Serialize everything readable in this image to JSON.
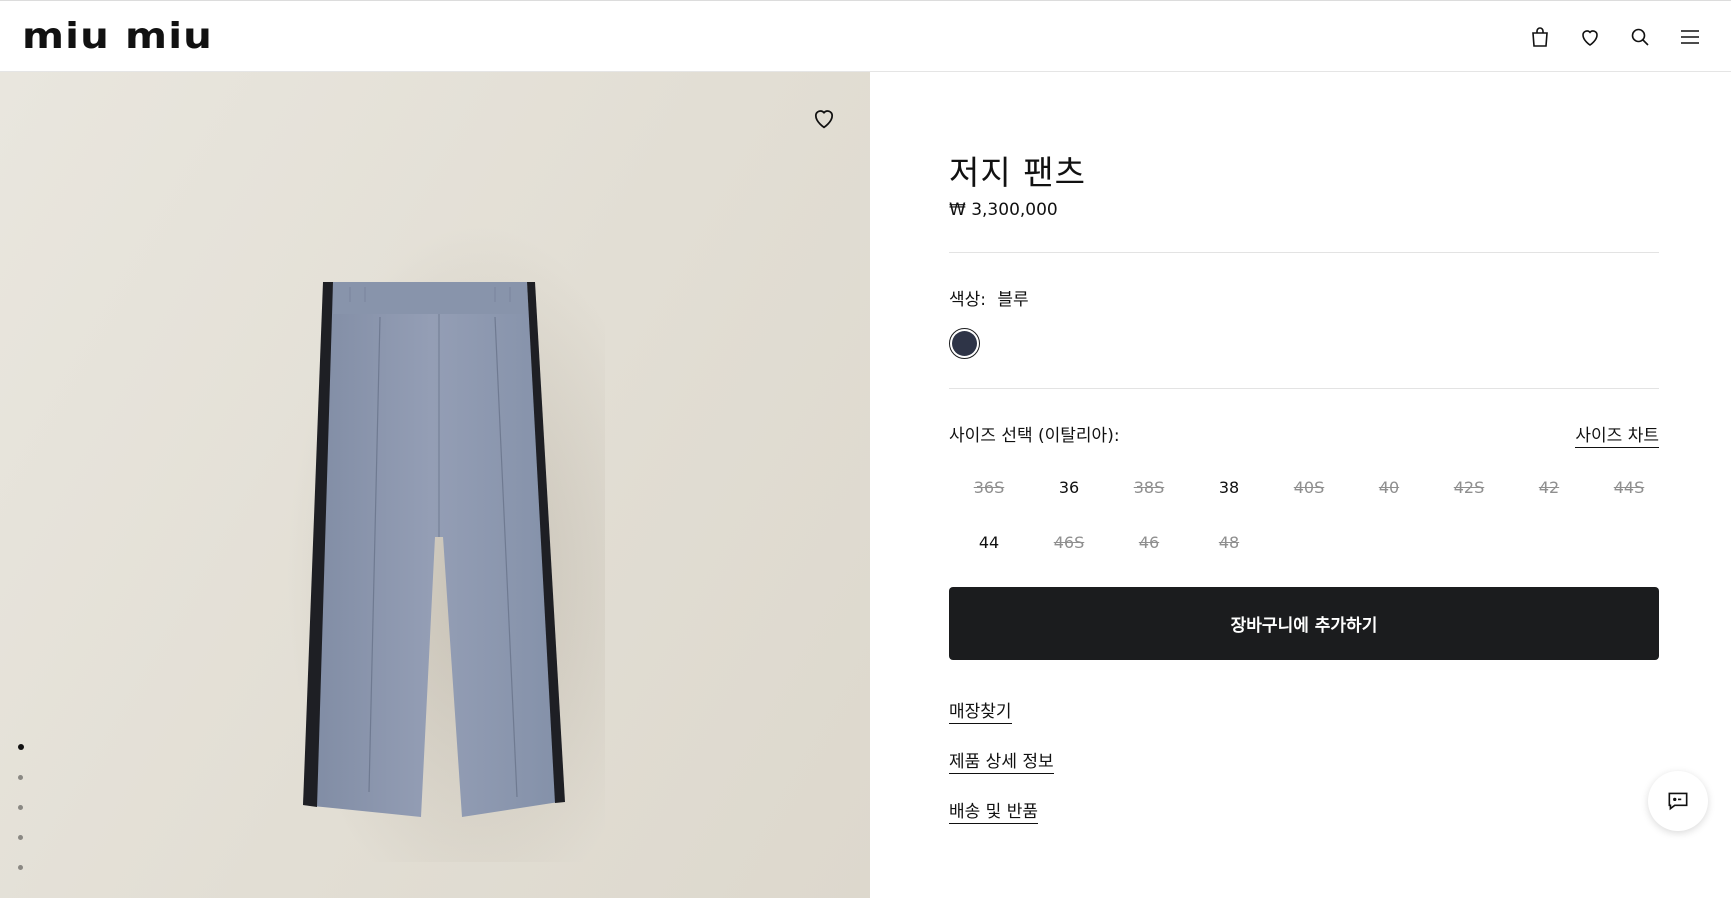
{
  "header": {
    "logo": "miu miu",
    "icons": [
      "bag-icon",
      "heart-icon",
      "search-icon",
      "menu-icon"
    ]
  },
  "gallery": {
    "wishlist_icon": "heart-icon",
    "dots_count": 5,
    "active_dot": 0
  },
  "product": {
    "title": "저지 팬츠",
    "price": "₩ 3,300,000",
    "color_label": "색상:",
    "color_value": "블루",
    "swatch_color": "#2e3447",
    "size_label": "사이즈 선택 (이탈리아):",
    "size_chart": "사이즈 차트",
    "sizes": [
      {
        "label": "36S",
        "available": false
      },
      {
        "label": "36",
        "available": true
      },
      {
        "label": "38S",
        "available": false
      },
      {
        "label": "38",
        "available": true
      },
      {
        "label": "40S",
        "available": false
      },
      {
        "label": "40",
        "available": false
      },
      {
        "label": "42S",
        "available": false
      },
      {
        "label": "42",
        "available": false
      },
      {
        "label": "44S",
        "available": false
      },
      {
        "label": "44",
        "available": true
      },
      {
        "label": "46S",
        "available": false
      },
      {
        "label": "46",
        "available": false
      },
      {
        "label": "48",
        "available": false
      }
    ],
    "add_to_cart": "장바구니에 추가하기",
    "links": {
      "store": "매장찾기",
      "details": "제품 상세 정보",
      "shipping": "배송 및 반품"
    }
  },
  "chat": {
    "icon": "chat-icon"
  }
}
